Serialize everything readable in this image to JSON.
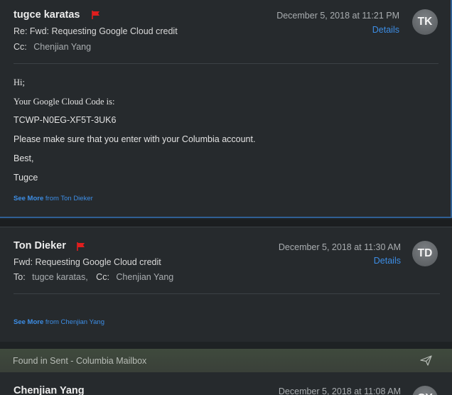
{
  "messages": [
    {
      "sender": "tugce karatas",
      "flagged": true,
      "date": "December 5, 2018 at 11:21 PM",
      "details_label": "Details",
      "avatar_initials": "TK",
      "subject": "Re: Fwd: Requesting Google Cloud credit",
      "cc_label": "Cc:",
      "cc_value": "Chenjian Yang",
      "body": {
        "greeting": "Hi;",
        "line1": "Your Google Cloud Code is:",
        "code": "TCWP-N0EG-XF5T-3UK6",
        "line2": "Please make sure that you enter with your Columbia account.",
        "closing": "Best,",
        "signature": "Tugce"
      },
      "see_more": "See More",
      "see_more_from": "from Ton Dieker"
    },
    {
      "sender": "Ton Dieker",
      "flagged": true,
      "date": "December 5, 2018 at 11:30 AM",
      "details_label": "Details",
      "avatar_initials": "TD",
      "subject": "Fwd: Requesting Google Cloud credit",
      "to_label": "To:",
      "to_value": "tugce karatas,",
      "cc_label": "Cc:",
      "cc_value": "Chenjian Yang",
      "see_more": "See More",
      "see_more_from": "from Chenjian Yang"
    },
    {
      "sender": "Chenjian Yang",
      "date": "December 5, 2018 at 11:08 AM",
      "avatar_initials": "CY"
    }
  ],
  "found_bar": {
    "text": "Found in Sent - Columbia Mailbox",
    "icon": "send-icon"
  },
  "colors": {
    "accent": "#3d8ee6",
    "flag": "#e01e1e",
    "selected_border": "#2f5f94"
  }
}
